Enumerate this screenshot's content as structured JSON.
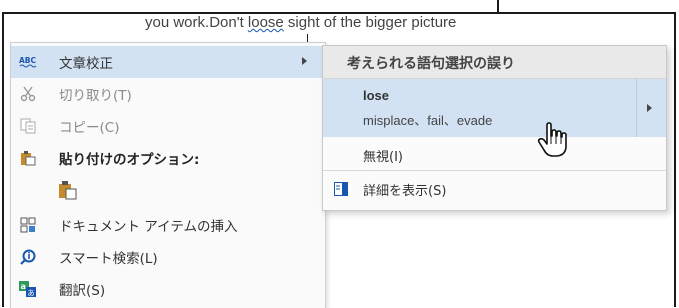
{
  "document": {
    "text_before": "you work.Don't ",
    "misspelled_word": "loose",
    "text_after": " sight of the bigger picture"
  },
  "context_menu": {
    "items": [
      {
        "label": "文章校正",
        "icon": "abc-proofing-icon",
        "has_submenu": true,
        "highlighted": true
      },
      {
        "label": "切り取り(T)",
        "icon": "scissors-icon",
        "disabled": true
      },
      {
        "label": "コピー(C)",
        "icon": "copy-icon",
        "disabled": true
      },
      {
        "label": "貼り付けのオプション:",
        "icon": "paste-icon",
        "bold": true
      },
      {
        "label": "",
        "icon": "paste-keep-source-icon"
      },
      {
        "label": "ドキュメント アイテムの挿入",
        "icon": "document-item-icon"
      },
      {
        "label": "スマート検索(L)",
        "icon": "smart-lookup-icon"
      },
      {
        "label": "翻訳(S)",
        "icon": "translate-icon"
      }
    ]
  },
  "submenu": {
    "header": "考えられる語句選択の誤り",
    "suggestion": {
      "word": "lose",
      "alternatives": "misplace、fail、evade"
    },
    "ignore_label": "無視(I)",
    "details_label": "詳細を表示(S)"
  },
  "colors": {
    "highlight": "#d2e2f3",
    "proofing_underline": "#1a56b0"
  }
}
